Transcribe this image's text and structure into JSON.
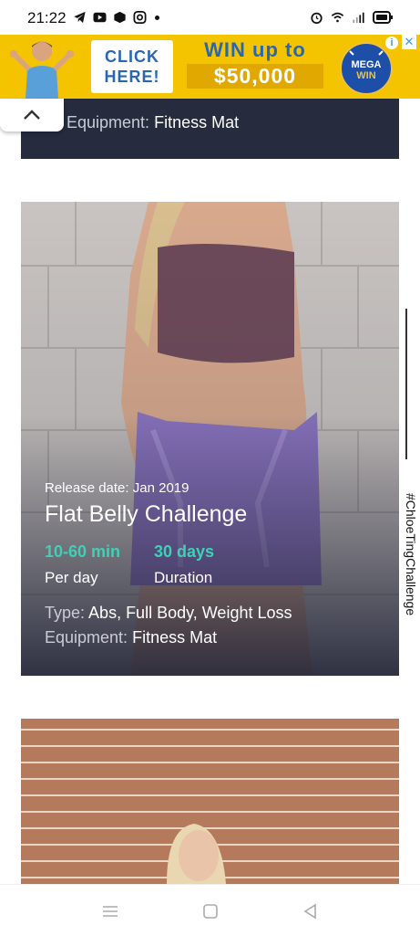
{
  "status_bar": {
    "time": "21:22",
    "left_icons": [
      "telegram-icon",
      "youtube-icon",
      "box-icon",
      "instagram-icon",
      "dot-icon"
    ],
    "right_icons": [
      "alarm-icon",
      "wifi-icon",
      "signal-icon",
      "battery-icon"
    ]
  },
  "ad": {
    "click_line1": "CLICK",
    "click_line2": "HERE!",
    "win_line1": "WIN up to",
    "win_line2": "$50,000",
    "logo_line1": "MEGA",
    "logo_line2": "WIN",
    "info": "i",
    "close": "✕"
  },
  "collapse_icon": "chevron-up-icon",
  "cards": [
    {
      "equipment_label": "Equipment:",
      "equipment_value": "Fitness Mat"
    },
    {
      "release_label": "Release date:",
      "release_value": "Jan 2019",
      "title": "Flat Belly Challenge",
      "stat1_value": "10-60 min",
      "stat1_label": "Per day",
      "stat2_value": "30 days",
      "stat2_label": "Duration",
      "type_label": "Type:",
      "type_value": "Abs, Full Body, Weight Loss",
      "equipment_label": "Equipment:",
      "equipment_value": "Fitness Mat"
    }
  ],
  "hashtag": "#ChloeTingChallenge",
  "colors": {
    "accent": "#3fd0b6",
    "card_dark": "#262b3e",
    "ad_yellow": "#f5c400"
  }
}
